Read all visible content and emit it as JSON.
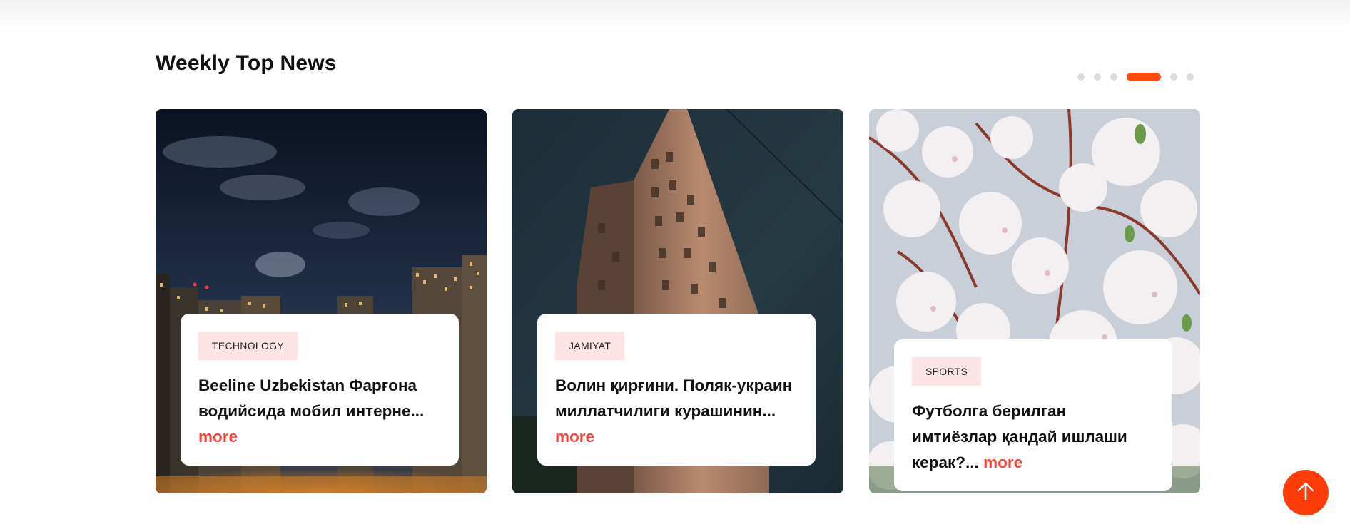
{
  "section": {
    "title": "Weekly Top News"
  },
  "pager": {
    "total": 6,
    "active_index": 3,
    "active_color": "#ff4a0f"
  },
  "cards": [
    {
      "category": "TECHNOLOGY",
      "title": "Beeline Uzbekistan Фарғона водийсида мобил интерне...",
      "more": "more",
      "image": "night-city-skyline"
    },
    {
      "category": "JAMIYAT",
      "title": "Волин қирғини. Поляк-украин миллатчилиги курашинин...",
      "more": "more",
      "image": "tall-apartment-building"
    },
    {
      "category": "SPORTS",
      "title": "Футболга берилган имтиёзлар қандай ишлаши керак?...",
      "more": "more",
      "image": "cherry-blossom-branches"
    }
  ],
  "colors": {
    "accent": "#ff3d0a",
    "more_link": "#f0443c",
    "badge_bg": "#fde4e4"
  },
  "scroll_top": {
    "icon": "arrow-up-icon"
  }
}
